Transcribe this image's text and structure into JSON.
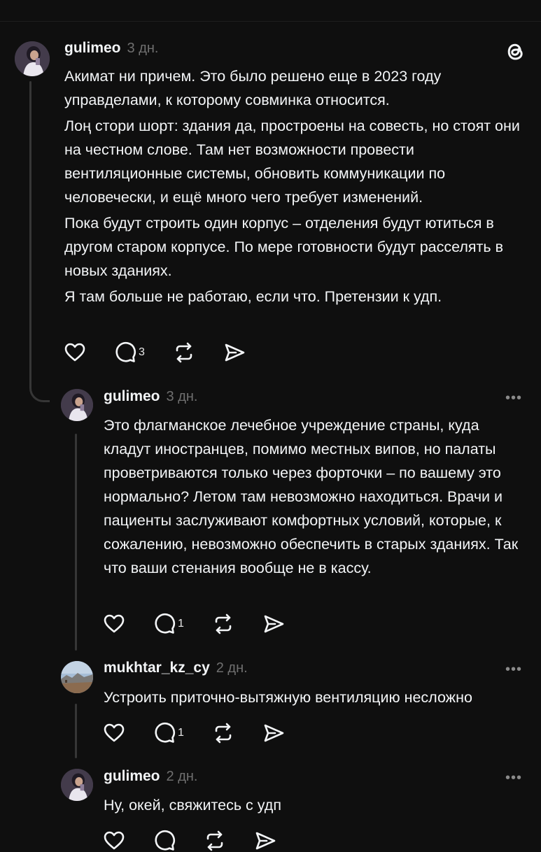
{
  "app": {
    "logo_icon": "threads-logo-icon"
  },
  "colors": {
    "background": "#0f0f0f",
    "text": "#f3f5f7",
    "muted": "#6f6f6f",
    "thread_line": "#363636"
  },
  "posts": [
    {
      "username": "gulimeo",
      "time": "3 дн.",
      "paragraphs": [
        "Акимат ни причем. Это было решено еще в 2023 году управделами, к которому совминка относится.",
        "Лоң стори шорт: здания да, простроены на совесть, но стоят они на честном слове. Там нет возможности провести вентиляционные системы, обновить коммуникации по человечески, и ещё много чего требует изменений.",
        "Пока будут строить один корпус – отделения будут ютиться в другом старом корпусе. По мере готовности будут расселять в новых зданиях.",
        "Я там больше не работаю, если что. Претензии к удп."
      ],
      "reply_count": "3"
    },
    {
      "username": "gulimeo",
      "time": "3 дн.",
      "more": "•••",
      "paragraphs": [
        "Это флагманское лечебное учреждение страны, куда кладут иностранцев, помимо местных випов, но палаты проветриваются только через форточки – по вашему это нормально? Летом там невозможно находиться. Врачи и пациенты заслуживают комфортных условий, которые, к сожалению, невозможно обеспечить в старых зданиях. Так что ваши стенания вообще не в кассу."
      ],
      "reply_count": "1"
    },
    {
      "username": "mukhtar_kz_cy",
      "time": "2 дн.",
      "more": "•••",
      "paragraphs": [
        "Устроить приточно-вытяжную вентиляцию несложно"
      ],
      "reply_count": "1"
    },
    {
      "username": "gulimeo",
      "time": "2 дн.",
      "more": "•••",
      "paragraphs": [
        "Ну, окей, свяжитесь с удп"
      ],
      "reply_count": ""
    }
  ]
}
